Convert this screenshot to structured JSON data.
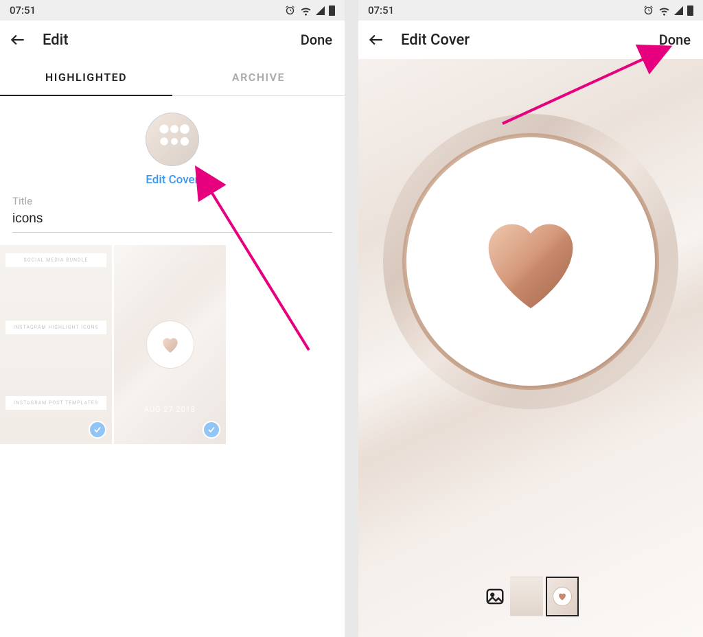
{
  "status": {
    "time": "07:51"
  },
  "left": {
    "header": {
      "title": "Edit",
      "done": "Done"
    },
    "tabs": {
      "highlighted": "HIGHLIGHTED",
      "archive": "ARCHIVE"
    },
    "edit_cover_link": "Edit Cover",
    "title_label": "Title",
    "title_value": "icons",
    "grid": {
      "item1_text1": "SOCIAL MEDIA BUNDLE",
      "item1_text2": "INSTAGRAM HIGHLIGHT ICONS",
      "item1_text3": "INSTAGRAM POST TEMPLATES",
      "item2_date": "AUG 27 2018"
    }
  },
  "right": {
    "header": {
      "title": "Edit Cover",
      "done": "Done"
    }
  },
  "colors": {
    "accent_blue": "#3897f0",
    "annotation_pink": "#e6007e",
    "rose_gold_1": "#e8b89d",
    "rose_gold_2": "#b47a5a"
  }
}
